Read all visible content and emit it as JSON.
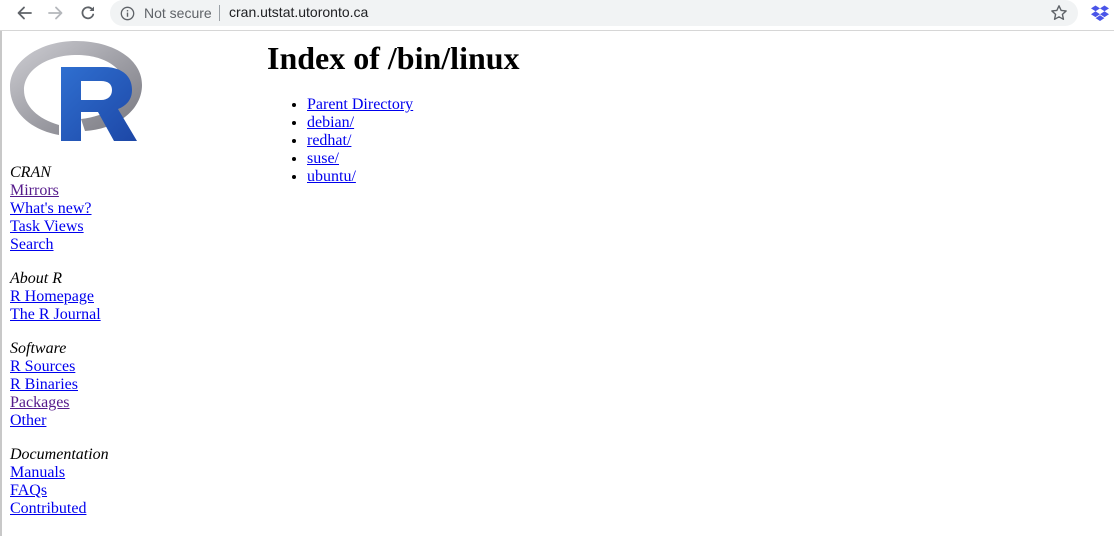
{
  "browser": {
    "security_label": "Not secure",
    "url": "cran.utstat.utoronto.ca",
    "icons": {
      "back": "arrow-left-icon",
      "forward": "arrow-right-icon",
      "reload": "reload-icon",
      "info": "info-icon",
      "bookmark": "star-icon",
      "extension": "dropbox-icon"
    }
  },
  "logo": {
    "letter": "R",
    "colors": {
      "ring": "#a9a9b0",
      "letter": "#2356b4"
    }
  },
  "page": {
    "title": "Index of /bin/linux",
    "entries": [
      {
        "label": "Parent Directory"
      },
      {
        "label": "debian/"
      },
      {
        "label": "redhat/"
      },
      {
        "label": "suse/"
      },
      {
        "label": "ubuntu/"
      }
    ]
  },
  "sidebar": {
    "sections": [
      {
        "heading": "CRAN",
        "links": [
          {
            "label": "Mirrors",
            "visited": true
          },
          {
            "label": "What's new?",
            "visited": false
          },
          {
            "label": "Task Views",
            "visited": false
          },
          {
            "label": "Search",
            "visited": false
          }
        ]
      },
      {
        "heading": "About R",
        "links": [
          {
            "label": "R Homepage",
            "visited": false
          },
          {
            "label": "The R Journal",
            "visited": false
          }
        ]
      },
      {
        "heading": "Software",
        "links": [
          {
            "label": "R Sources",
            "visited": false
          },
          {
            "label": "R Binaries",
            "visited": false
          },
          {
            "label": "Packages",
            "visited": true
          },
          {
            "label": "Other",
            "visited": false
          }
        ]
      },
      {
        "heading": "Documentation",
        "links": [
          {
            "label": "Manuals",
            "visited": false
          },
          {
            "label": "FAQs",
            "visited": false
          },
          {
            "label": "Contributed",
            "visited": false
          }
        ]
      }
    ]
  }
}
